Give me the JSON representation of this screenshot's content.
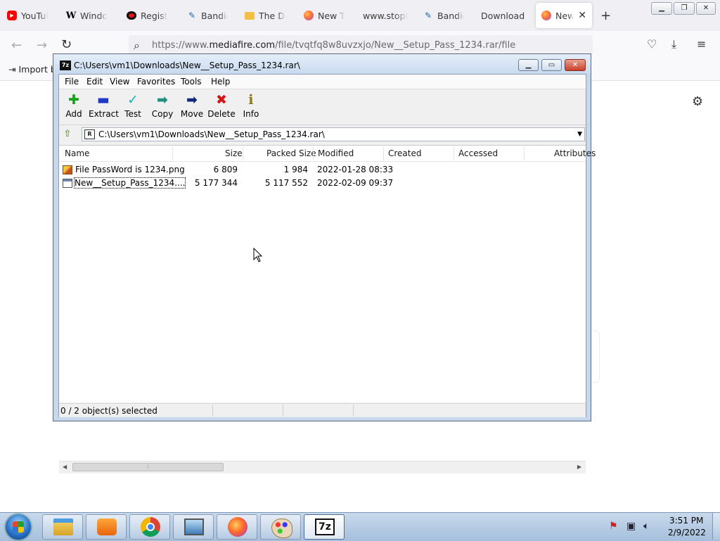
{
  "browser": {
    "tabs": [
      {
        "label": "YouTube",
        "icon": "youtube-icon"
      },
      {
        "label": "Windows",
        "icon": "wikipedia-icon"
      },
      {
        "label": "Registration",
        "icon": "record-icon"
      },
      {
        "label": "Bandicam",
        "icon": "bandicam-icon"
      },
      {
        "label": "The Do",
        "icon": "folder-icon"
      },
      {
        "label": "New Tab",
        "icon": "firefox-icon"
      },
      {
        "label": "www.stopbanner",
        "icon": "none"
      },
      {
        "label": "Bandicam",
        "icon": "bandicam-icon"
      },
      {
        "label": "Download",
        "icon": "none"
      },
      {
        "label": "New Tab",
        "icon": "firefox-icon",
        "active": true
      }
    ],
    "new_tab_glyph": "+",
    "url_prefix": "https://www.",
    "url_domain": "mediafire.com",
    "url_rest": "/file/tvqtfq8w8uvzxjo/New__Setup_Pass_1234.rar/file",
    "import_bookmarks_label": "Import b"
  },
  "sevenzip": {
    "title": "C:\\Users\\vm1\\Downloads\\New__Setup_Pass_1234.rar\\",
    "menu": [
      "File",
      "Edit",
      "View",
      "Favorites",
      "Tools",
      "Help"
    ],
    "toolbar": [
      {
        "label": "Add",
        "icon": "add-icon",
        "glyph": "✚",
        "color": "#1aa31a"
      },
      {
        "label": "Extract",
        "icon": "extract-icon",
        "glyph": "▬",
        "color": "#2038c8"
      },
      {
        "label": "Test",
        "icon": "test-icon",
        "glyph": "✓",
        "color": "#1bb0b0"
      },
      {
        "label": "Copy",
        "icon": "copy-icon",
        "glyph": "➡",
        "color": "#1f8f7f"
      },
      {
        "label": "Move",
        "icon": "move-icon",
        "glyph": "➡",
        "color": "#102a80"
      },
      {
        "label": "Delete",
        "icon": "delete-icon",
        "glyph": "✖",
        "color": "#d21414"
      },
      {
        "label": "Info",
        "icon": "info-icon",
        "glyph": "ℹ",
        "color": "#8a7a10"
      }
    ],
    "path": "C:\\Users\\vm1\\Downloads\\New__Setup_Pass_1234.rar\\",
    "columns": [
      "Name",
      "Size",
      "Packed Size",
      "Modified",
      "Created",
      "Accessed",
      "Attributes"
    ],
    "files": [
      {
        "name": "File PassWord is 1234.png",
        "size": "6 809",
        "packed": "1 984",
        "modified": "2022-01-28 08:33",
        "type": "png"
      },
      {
        "name": "New__Setup_Pass_1234....",
        "size": "5 177 344",
        "packed": "5 117 552",
        "modified": "2022-02-09 09:37",
        "type": "rar"
      }
    ],
    "status": "0 / 2 object(s) selected"
  },
  "taskbar": {
    "apps": [
      "explorer",
      "media-center",
      "chrome",
      "photo-viewer",
      "firefox",
      "paint",
      "7-zip"
    ],
    "sevenzip_label": "7z",
    "time": "3:51 PM",
    "date": "2/9/2022"
  }
}
